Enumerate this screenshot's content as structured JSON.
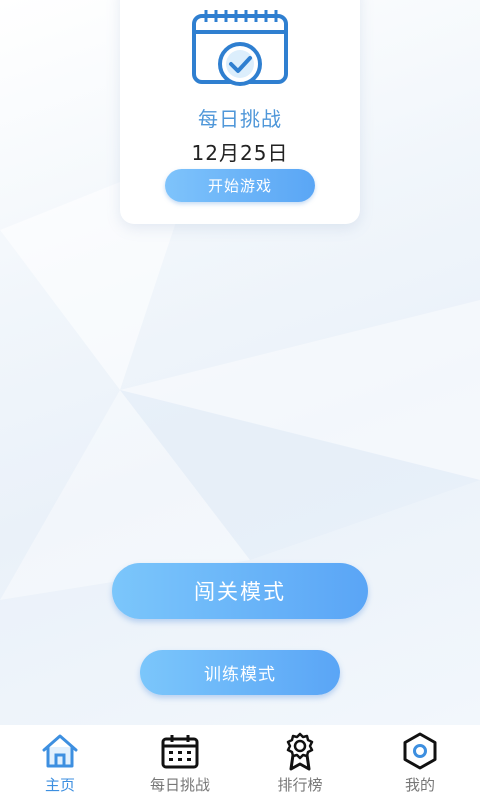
{
  "daily_card": {
    "title": "每日挑战",
    "date": "12月25日",
    "start_label": "开始游戏",
    "icon": "calendar-check-icon"
  },
  "modes": {
    "level_mode_label": "闯关模式",
    "training_mode_label": "训练模式"
  },
  "tabbar": {
    "items": [
      {
        "label": "主页",
        "icon": "home-icon",
        "active": true
      },
      {
        "label": "每日挑战",
        "icon": "calendar-icon",
        "active": false
      },
      {
        "label": "排行榜",
        "icon": "ribbon-badge-icon",
        "active": false
      },
      {
        "label": "我的",
        "icon": "hexagon-icon",
        "active": false
      }
    ]
  },
  "colors": {
    "accent": "#4f97d9",
    "button_gradient_start": "#7bc6fb",
    "button_gradient_end": "#5aa5f6",
    "active_tab": "#3d8fe0"
  }
}
